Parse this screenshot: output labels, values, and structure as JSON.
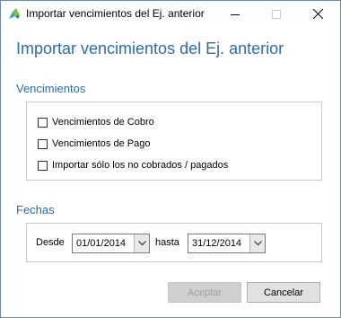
{
  "window": {
    "title": "Importar vencimientos del Ej. anterior"
  },
  "heading": "Importar vencimientos del Ej. anterior",
  "vencimientos": {
    "label": "Vencimientos",
    "options": [
      {
        "label": "Vencimientos de Cobro",
        "checked": false
      },
      {
        "label": "Vencimientos de Pago",
        "checked": false
      },
      {
        "label": "Importar sólo los no cobrados / pagados",
        "checked": false
      }
    ]
  },
  "fechas": {
    "label": "Fechas",
    "desde_label": "Desde",
    "desde_value": "01/01/2014",
    "hasta_label": "hasta",
    "hasta_value": "31/12/2014"
  },
  "buttons": {
    "accept_label": "Aceptar",
    "cancel_label": "Cancelar"
  },
  "colors": {
    "accent": "#2f6ba8"
  }
}
